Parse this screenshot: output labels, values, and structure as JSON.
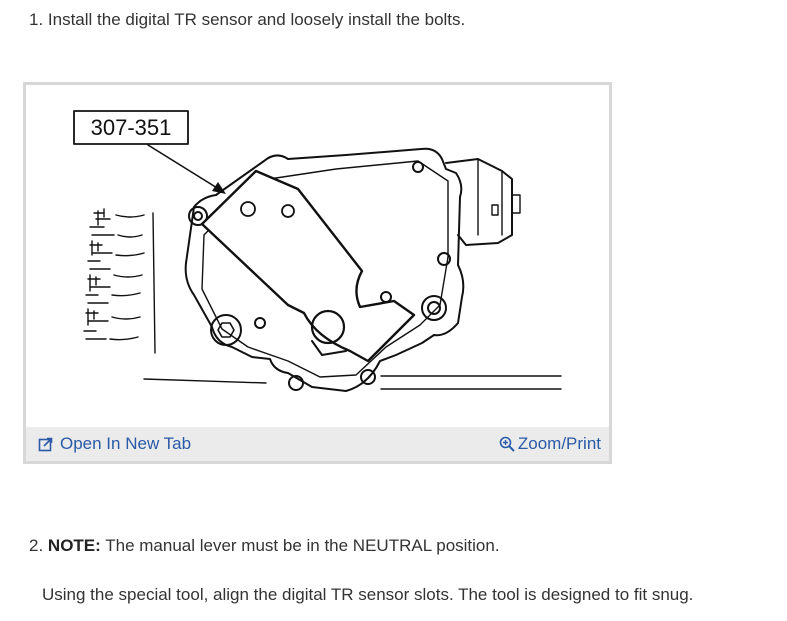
{
  "steps": {
    "step1": {
      "text": "1. Install the digital TR sensor and loosely install the bolts."
    },
    "step2": {
      "number": "2.",
      "note_label": "NOTE:",
      "note_text": "The manual lever must be in the NEUTRAL position.",
      "detail": "Using the special tool, align the digital TR sensor slots. The tool is designed to fit snug."
    }
  },
  "figure": {
    "callout_label": "307-351",
    "footer": {
      "open_label": "Open In New Tab",
      "open_icon": "external-link-icon",
      "zoom_label": "Zoom/Print",
      "zoom_icon": "magnifier-plus-icon"
    }
  },
  "colors": {
    "link": "#2a5aa8",
    "footer_background": "#ebebeb",
    "frame_border": "#d7d7d7",
    "body_text": "#333333"
  }
}
